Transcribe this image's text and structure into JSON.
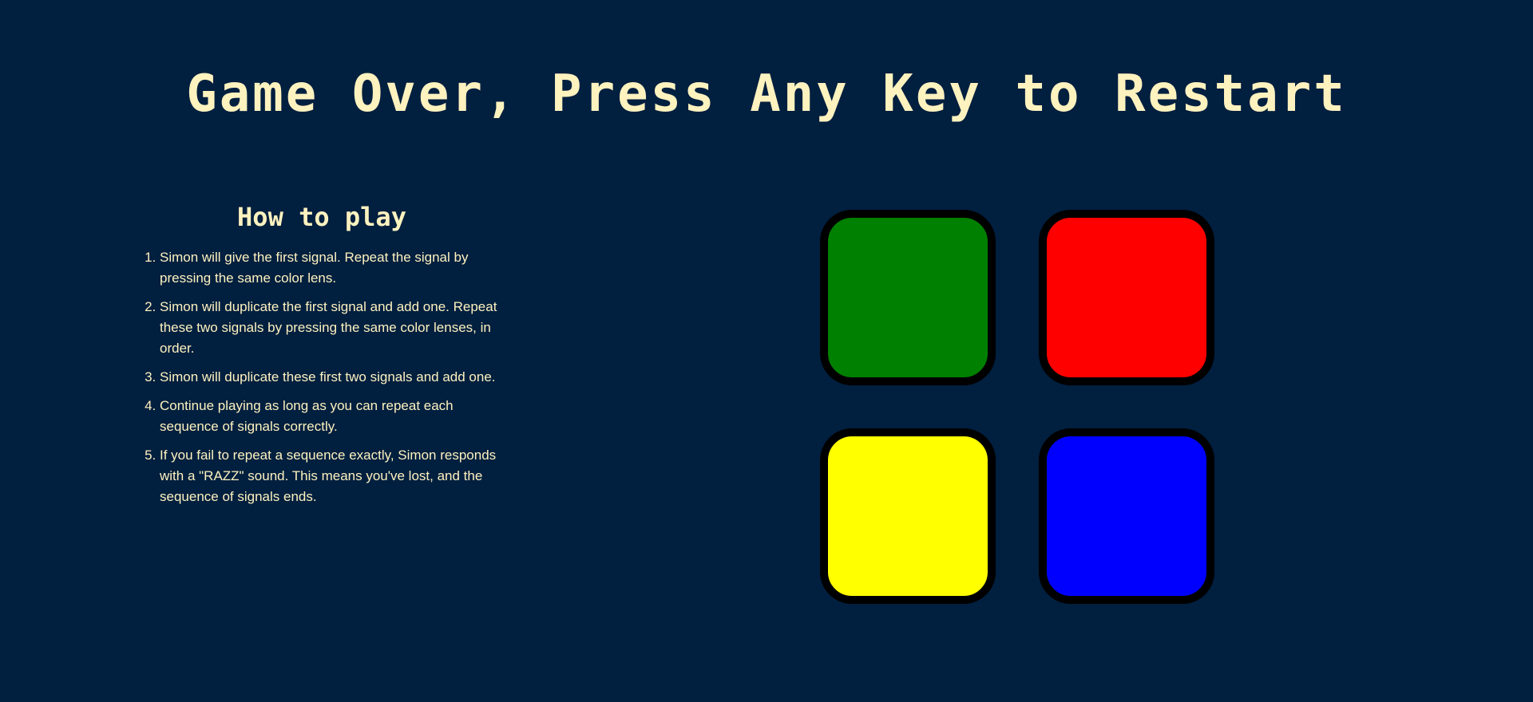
{
  "title": "Game Over, Press Any Key to Restart",
  "instructions": {
    "heading": "How to play",
    "steps": [
      "Simon will give the first signal. Repeat the signal by pressing the same color lens.",
      "Simon will duplicate the first signal and add one. Repeat these two signals by pressing the same color lenses, in order.",
      "Simon will duplicate these first two signals and add one.",
      "Continue playing as long as you can repeat each sequence of signals correctly.",
      "If you fail to repeat a sequence exactly, Simon responds with a \"RAZZ\" sound. This means you've lost, and the sequence of signals ends."
    ]
  },
  "buttons": [
    {
      "id": "green",
      "color": "#008000"
    },
    {
      "id": "red",
      "color": "#FF0000"
    },
    {
      "id": "yellow",
      "color": "#FFFF00"
    },
    {
      "id": "blue",
      "color": "#0000FF"
    }
  ],
  "colors": {
    "background": "#011F3F",
    "text": "#FEF2BF",
    "button_border": "#000000"
  }
}
